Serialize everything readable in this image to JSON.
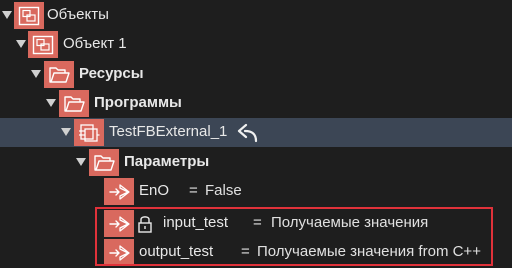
{
  "tree": {
    "items": [
      {
        "label": "Объекты",
        "icon": "object-block-icon",
        "expanded": true
      },
      {
        "label": "Объект 1",
        "icon": "object-block-icon",
        "expanded": true
      },
      {
        "label": "Ресурсы",
        "icon": "folder-icon",
        "expanded": true
      },
      {
        "label": "Программы",
        "icon": "folder-icon",
        "expanded": true
      },
      {
        "label": "TestFBExternal_1",
        "icon": "function-block-icon",
        "expanded": true,
        "selected": true,
        "action_icon": "undo-arrow-icon"
      },
      {
        "label": "Параметры",
        "icon": "folder-icon",
        "expanded": true
      },
      {
        "label": "EnO",
        "icon": "parameter-arrow-icon",
        "equals": "=",
        "value": "False"
      },
      {
        "label": "input_test",
        "icon": "parameter-arrow-icon",
        "lock_icon": "lock-icon",
        "equals": "=",
        "value": "Получаемые значения"
      },
      {
        "label": "output_test",
        "icon": "parameter-arrow-icon",
        "equals": "=",
        "value": "Получаемые значения from C++"
      }
    ]
  },
  "colors": {
    "background": "#1e1e1e",
    "icon_fill": "#d9695e",
    "selected_row": "#3c4655",
    "highlight_border": "#e0323a"
  }
}
